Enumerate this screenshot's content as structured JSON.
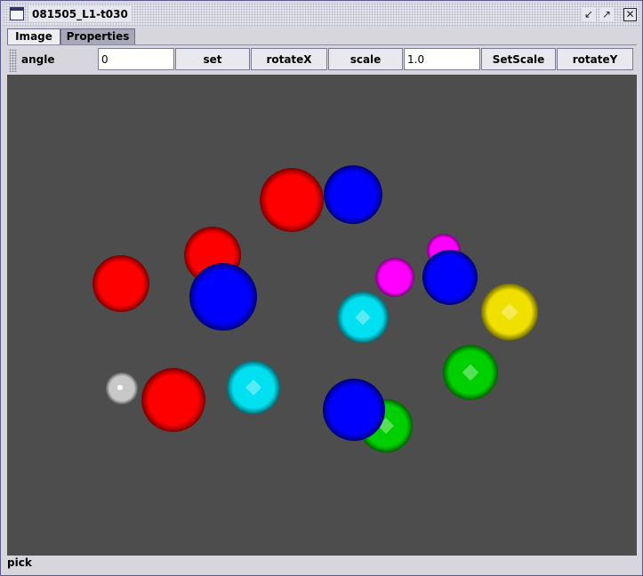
{
  "window": {
    "title": "081505_L1-t030",
    "minimize_glyph": "↙",
    "maximize_glyph": "↗",
    "close_glyph": "✕"
  },
  "tabs": [
    {
      "label": "Image",
      "active": true
    },
    {
      "label": "Properties",
      "active": false
    }
  ],
  "toolbar": {
    "angle_label": "angle",
    "angle_value": "0",
    "set_label": "set",
    "rotatex_label": "rotateX",
    "scale_label": "scale",
    "scale_value": "1.0",
    "setscale_label": "SetScale",
    "rotatey_label": "rotateY"
  },
  "status": {
    "text": "pick"
  },
  "colors": {
    "canvas_background": "#4d4d4d",
    "red": "#ff0000",
    "blue": "#0000ff",
    "magenta": "#ff00ff",
    "cyan": "#00e0f0",
    "yellow": "#f0e000",
    "green": "#00d000",
    "gray": "#c8c8c8"
  },
  "spheres": [
    {
      "color": "red"
    },
    {
      "color": "blue"
    },
    {
      "color": "red"
    },
    {
      "color": "red"
    },
    {
      "color": "blue"
    },
    {
      "color": "magenta"
    },
    {
      "color": "magenta"
    },
    {
      "color": "blue"
    },
    {
      "color": "cyan"
    },
    {
      "color": "yellow"
    },
    {
      "color": "green"
    },
    {
      "color": "gray"
    },
    {
      "color": "red"
    },
    {
      "color": "cyan"
    },
    {
      "color": "green"
    },
    {
      "color": "blue"
    }
  ]
}
